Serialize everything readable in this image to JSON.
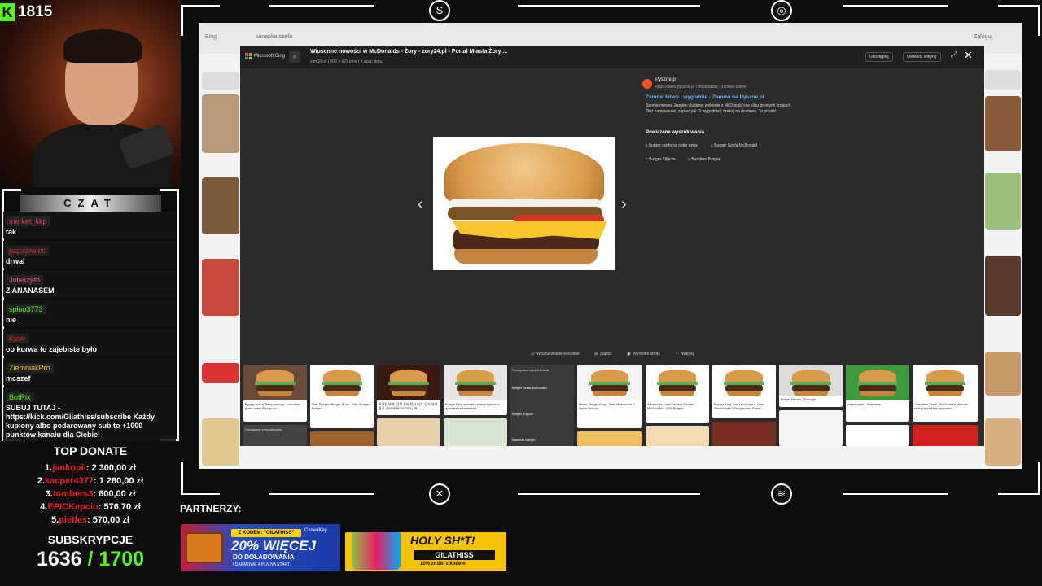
{
  "stream": {
    "viewer_count": "1815",
    "chat_title": "CZAT",
    "chat": [
      {
        "user": "merket_kkp",
        "text": "tak",
        "color": "#e83a5e"
      },
      {
        "user": "papajowiec",
        "text": "drwal",
        "color": "#e8212a"
      },
      {
        "user": "Jotekzjeb",
        "text": "Z ANANASEM",
        "color": "#e85a8a"
      },
      {
        "user": "spino3773",
        "text": "nie",
        "color": "#53fc18"
      },
      {
        "user": "Ksvir",
        "text": "oo kurwa to zajebiste było",
        "color": "#e8212a"
      },
      {
        "user": "ZiemniakPro",
        "text": "mcszef",
        "color": "#f5c542"
      },
      {
        "user": "BotRix",
        "text": "SUBUJ TUTAJ - https://kick.com/Gilathiss/subscribe Każdy kupiony albo podarowany sub to +1000 punktów kanału dla Ciebie!",
        "color": "#53fc18"
      }
    ],
    "top_donate_title": "TOP DONATE",
    "donors": [
      {
        "rank": "1.",
        "name": "jankopil",
        "amount": ": 2 300,00 zł"
      },
      {
        "rank": "2.",
        "name": "kacper4377",
        "amount": ": 1 280,00 zł"
      },
      {
        "rank": "3.",
        "name": "tombers3",
        "amount": ": 600,00 zł"
      },
      {
        "rank": "4.",
        "name": "EPICKepcio",
        "amount": ": 576,70 zł"
      },
      {
        "rank": "5.",
        "name": "pietles",
        "amount": ": 570,00 zł"
      }
    ],
    "subs_title": "SUBSKRYPCJE",
    "subs_current": "1636",
    "subs_goal": " / 1700",
    "partners_label": "PARTNERZY:",
    "banner1": {
      "code": "Z KODEM: \"GILATHISS\"",
      "headline": "20% WIĘCEJ",
      "line2": "DO DOŁADOWANIA",
      "line3": "I DARMOWE 4 PLN NA START",
      "brand": "Case4Key"
    },
    "banner2": {
      "headline": "HOLY SH*T!",
      "code": "GILATHISS",
      "offer": "10% zniżki z kodem"
    }
  },
  "browser": {
    "bing_label": "Bing",
    "query": "kanapka szefa",
    "signin": "Zaloguj"
  },
  "modal": {
    "brand": "Microsoft Bing",
    "title": "Wiosenne nowości w McDonalds - Żory - zory24.pl - Portal Miasta Żory ...",
    "subtitle": "zory24.pl  |  600 × 421 jpeg  |  4 szcz. tenu",
    "share": "Udostępnij",
    "visit": "Odwiedź witrynę",
    "source_name": "Pyszne.pl",
    "source_url": "https://www.pyszne.pl › mcdonalds › zamow-online",
    "ad_title": "Zamów łatwo i wygodnie - Zamów na Pyszne.pl",
    "ad_desc": "Sponsorowane  Zamów ulubione jedzenie z McDonald's w kilku prostych krokach. Złóż zamówienie, zapłać jak Ci wygodnie i czekaj na dostawę. To proste!",
    "related_title": "Powiązane wyszukiwania",
    "related": [
      "burger szefa na ostro cena",
      "Burger Szefa McDonald",
      "Burger Zdjęcie",
      "Bandero Burger"
    ],
    "actions": [
      "Wyszukiwanie wizualne",
      "Zapisz",
      "Wyświetl obraz",
      "Więcej"
    ],
    "tiles": [
      {
        "caption": "Бургер как в Макдональдс - готовим дома сами быстро и ..."
      },
      {
        "caption": "Star-Shaped Burger Buns : Star-Shaped Burger"
      },
      {
        "caption": "버거킹 와퍼, 김치 좋아 먼저 버거 '김치 와퍼' 출시 | HYPEBEASTKR | 하..."
      },
      {
        "caption": "Burger King animaba a las mujeres a quedarse embarazad..."
      },
      {
        "caption": "Powiązane wyszukiwania"
      },
      {
        "caption": "News: Burger King - New Mushroom & Swiss Bacon..."
      },
      {
        "caption": "Adventures of a Comfort Foodie: McDonald's 1955 Burger..."
      },
      {
        "caption": "Burger King Just Launched a New Steakhouse Whopper and Fans..."
      },
      {
        "caption": "Burger Ranch - Portugal"
      },
      {
        "caption": "Hamburger - burgerme"
      },
      {
        "caption": "Canadian Slack: McDonald's fans are raving about the upgraded..."
      }
    ],
    "related_tiles": [
      "Burger Szefa McDonald",
      "Burger Zdjęcie",
      "Bandero Burger"
    ],
    "related_left": "Powiązane wyszukiwania"
  },
  "colors": {
    "kick_green": "#53fc18",
    "donor_red": "#e8212a",
    "bing_link": "#6ab0ff"
  }
}
